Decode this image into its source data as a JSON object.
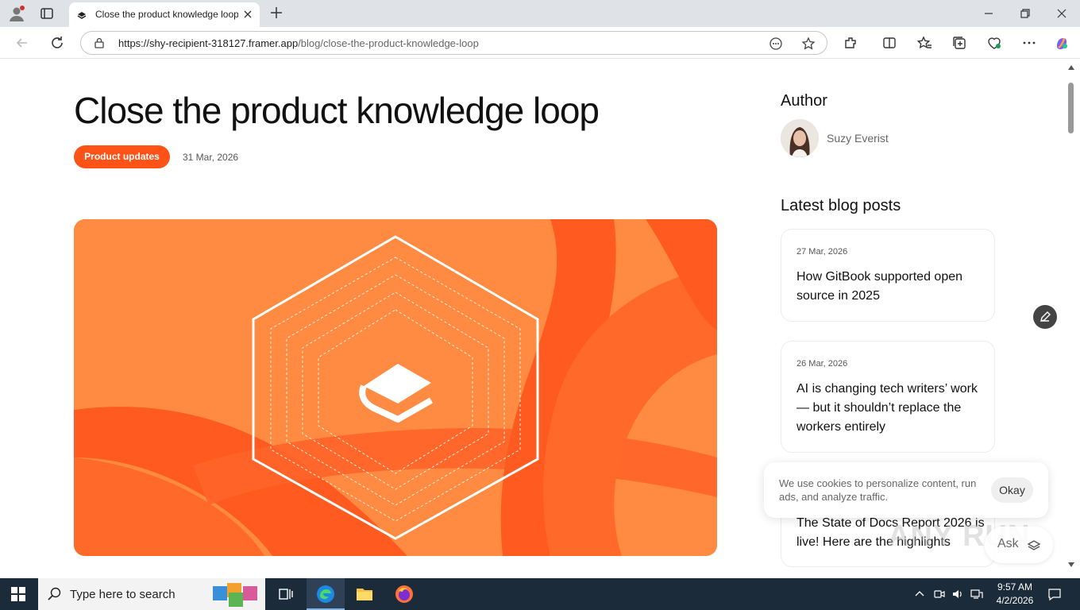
{
  "browser": {
    "tab_title": "Close the product knowledge loop",
    "url_host": "https://shy-recipient-318127.framer.app",
    "url_path": "/blog/close-the-product-knowledge-loop"
  },
  "post": {
    "title": "Close the product knowledge loop",
    "category": "Product updates",
    "date": "31 Mar, 2026"
  },
  "sidebar": {
    "author_heading": "Author",
    "author_name": "Suzy Everist",
    "latest_heading": "Latest blog posts",
    "posts": [
      {
        "date": "27 Mar, 2026",
        "title": "How GitBook supported open source in 2025"
      },
      {
        "date": "26 Mar, 2026",
        "title": "AI is changing tech writers’ work — but it shouldn’t replace the workers entirely"
      },
      {
        "date": "",
        "title": "The State of Docs Report 2026 is live! Here are the highlights"
      }
    ]
  },
  "cookie": {
    "text": "We use cookies to personalize content, run ads, and analyze traffic.",
    "ok_label": "Okay"
  },
  "ask": {
    "label": "Ask"
  },
  "watermark": "ANY RUN",
  "taskbar": {
    "search_placeholder": "Type here to search",
    "time": "9:57 AM",
    "date": "4/2/2026"
  },
  "colors": {
    "accent": "#fe5217",
    "taskbar": "#1c2b3a"
  }
}
